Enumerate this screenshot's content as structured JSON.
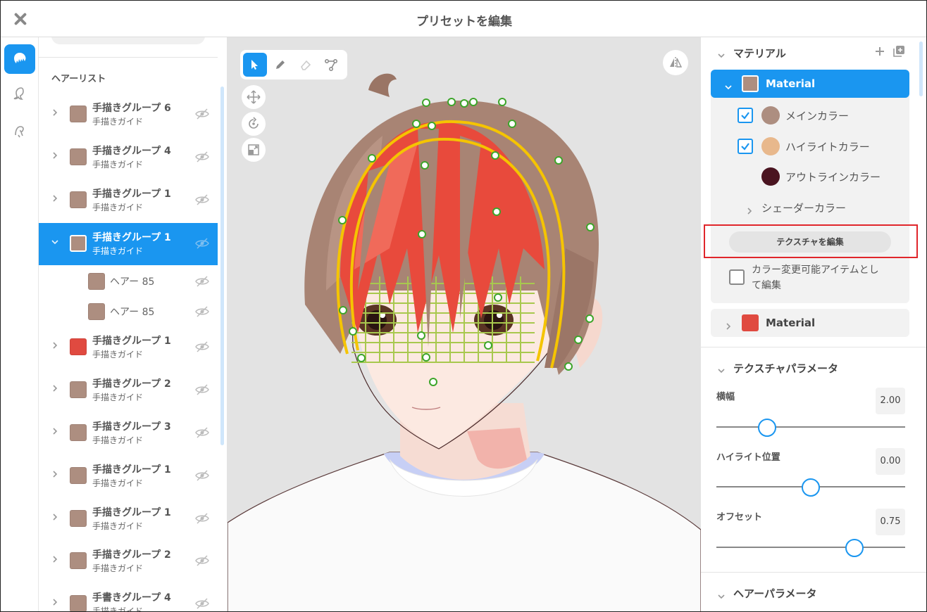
{
  "window": {
    "title": "プリセットを編集"
  },
  "hair_list": {
    "heading": "ヘアーリスト",
    "rows": [
      {
        "title": "手描きグループ 6",
        "sub": "手描きガイド",
        "color": "#ad8e80"
      },
      {
        "title": "手描きグループ 4",
        "sub": "手描きガイド",
        "color": "#ad8e80"
      },
      {
        "title": "手描きグループ 1",
        "sub": "手描きガイド",
        "color": "#ad8e80"
      },
      {
        "title": "手描きグループ 1",
        "sub": "手描きガイド",
        "color": "#ad8e80",
        "selected": true
      },
      {
        "title": "手描きグループ 1",
        "sub": "手描きガイド",
        "color": "#e04a40"
      },
      {
        "title": "手描きグループ 2",
        "sub": "手描きガイド",
        "color": "#ad8e80"
      },
      {
        "title": "手描きグループ 3",
        "sub": "手描きガイド",
        "color": "#ad8e80"
      },
      {
        "title": "手描きグループ 1",
        "sub": "手描きガイド",
        "color": "#ad8e80"
      },
      {
        "title": "手描きグループ 1",
        "sub": "手描きガイド",
        "color": "#ad8e80"
      },
      {
        "title": "手描きグループ 2",
        "sub": "手描きガイド",
        "color": "#ad8e80"
      },
      {
        "title": "手書きグループ 4",
        "sub": "手描きガイド",
        "color": "#ad8e80"
      }
    ],
    "children": [
      {
        "title": "ヘアー 85",
        "color": "#ad8e80"
      },
      {
        "title": "ヘアー 85",
        "color": "#ad8e80"
      }
    ]
  },
  "material_section": {
    "heading": "マテリアル",
    "material_1": {
      "label": "Material",
      "color": "#ad8e80",
      "main_color_label": "メインカラー",
      "main_color": "#ad8e80",
      "highlight_color_label": "ハイライトカラー",
      "highlight_color": "#e8b88c",
      "outline_color_label": "アウトラインカラー",
      "outline_color": "#4a1420",
      "shader_color_label": "シェーダーカラー",
      "edit_texture_label": "テクスチャを編集",
      "editable_item_label_1": "カラー変更可能アイテムとし",
      "editable_item_label_2": "て編集"
    },
    "material_2": {
      "label": "Material",
      "color": "#e04a40"
    }
  },
  "texture_params": {
    "heading": "テクスチャパラメータ",
    "width": {
      "label": "横幅",
      "value": "2.00",
      "fraction": 0.27
    },
    "highlight_pos": {
      "label": "ハイライト位置",
      "value": "0.00",
      "fraction": 0.5
    },
    "offset": {
      "label": "オフセット",
      "value": "0.75",
      "fraction": 0.73
    }
  },
  "hair_params": {
    "heading": "ヘアーパラメータ"
  },
  "colors": {
    "accent": "#1a96f0",
    "highlight_frame": "#e0262b"
  }
}
